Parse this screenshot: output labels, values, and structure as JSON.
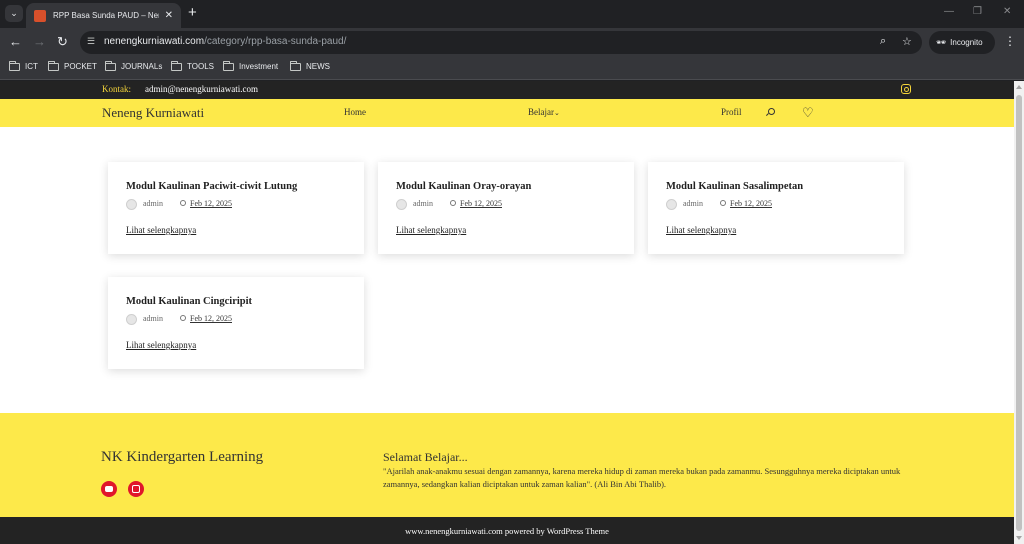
{
  "browser": {
    "tab_title": "RPP Basa Sunda PAUD – Neneng",
    "url_host": "nenengkurniawati.com",
    "url_path": "/category/rpp-basa-sunda-paud/",
    "incognito_label": "Incognito",
    "bookmarks": [
      "ICT",
      "POCKET",
      "JOURNALs",
      "TOOLS",
      "Investment",
      "NEWS"
    ]
  },
  "topbar": {
    "kontak_label": "Kontak:",
    "email": "admin@nenengkurniawati.com"
  },
  "header": {
    "site_title": "Neneng Kurniawati",
    "menu": [
      "Home",
      "Belajar",
      "Profil"
    ],
    "dropdown_glyph": "⌄"
  },
  "posts": [
    {
      "title": "Modul Kaulinan Paciwit-ciwit Lutung",
      "author": "admin",
      "date": "Feb 12, 2025",
      "more": "Lihat selengkapnya"
    },
    {
      "title": "Modul Kaulinan Oray-orayan",
      "author": "admin",
      "date": "Feb 12, 2025",
      "more": "Lihat selengkapnya"
    },
    {
      "title": "Modul Kaulinan Sasalimpetan",
      "author": "admin",
      "date": "Feb 12, 2025",
      "more": "Lihat selengkapnya"
    },
    {
      "title": "Modul Kaulinan Cingciripit",
      "author": "admin",
      "date": "Feb 12, 2025",
      "more": "Lihat selengkapnya"
    }
  ],
  "footer": {
    "title": "NK Kindergarten Learning",
    "heading": "Selamat Belajar...",
    "quote": "\"Ajarilah anak-anakmu sesuai dengan zamannya, karena mereka hidup di zaman mereka bukan pada zamanmu. Sesungguhnya mereka diciptakan untuk zamannya, sedangkan kalian diciptakan untuk zaman kalian\". (Ali Bin Abi Thalib).",
    "credit": "www.nenengkurniawati.com powered by WordPress Theme"
  },
  "colors": {
    "accent_yellow": "#fde94a",
    "dark_bar": "#232323",
    "social_red": "#e0162b"
  }
}
